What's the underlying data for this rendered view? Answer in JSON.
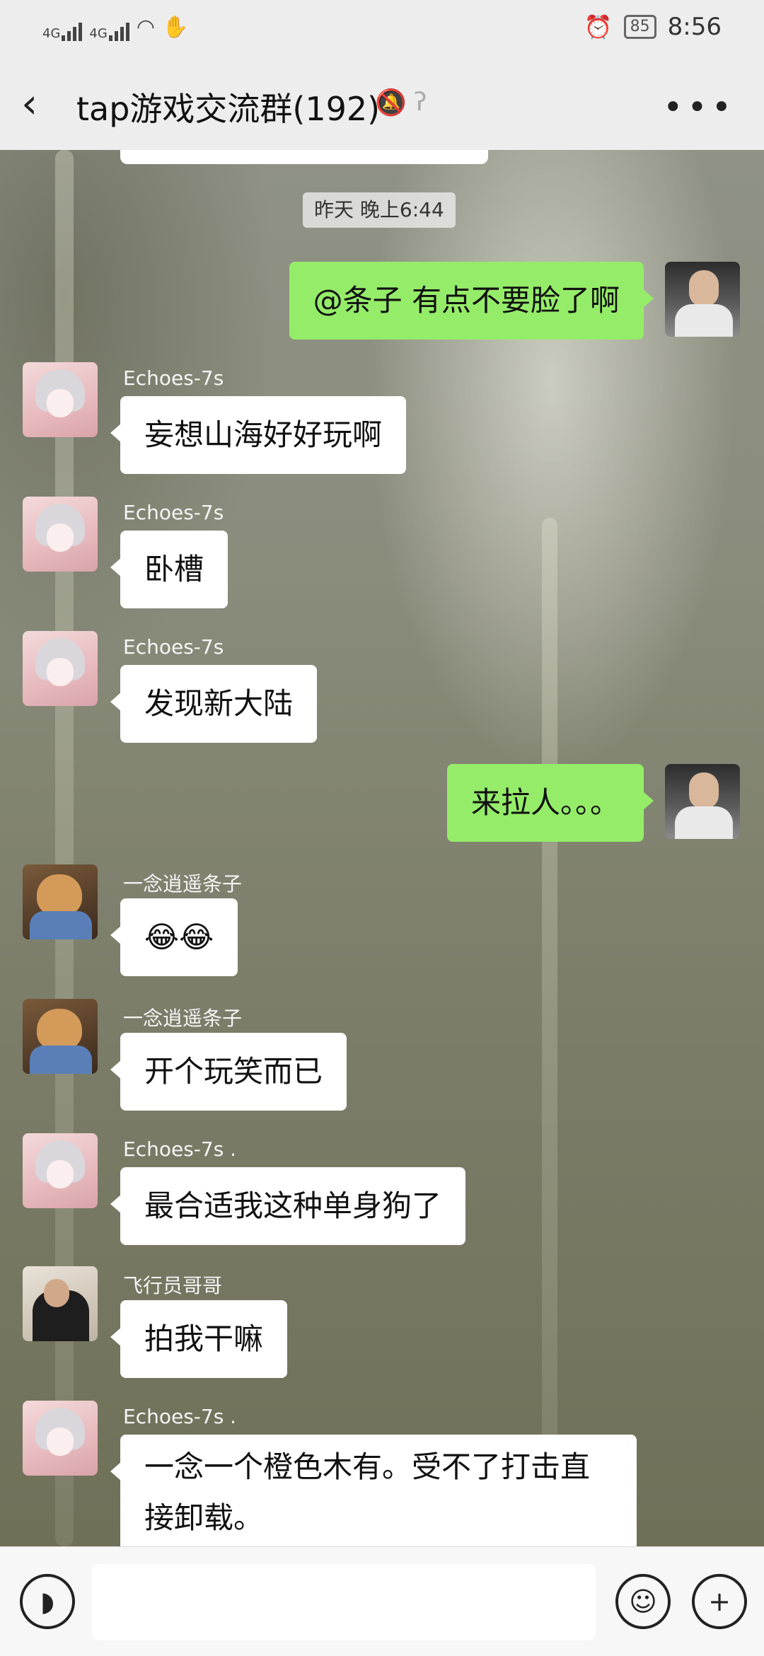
{
  "status_bar": {
    "signal1": "4G",
    "signal2": "4G",
    "battery": "85",
    "time": "8:56"
  },
  "header": {
    "back_icon": "chevron-left",
    "title": "tap游戏交流群(192)",
    "mute_icon": "bell-off",
    "ear_icon": "ear",
    "more_icon": "more-dots"
  },
  "chat": {
    "timestamp": "昨天 晚上6:44",
    "messages": [
      {
        "type": "out",
        "text": "@条子  有点不要脸了啊"
      },
      {
        "type": "in",
        "sender": "Echoes-7s",
        "text": "妄想山海好好玩啊"
      },
      {
        "type": "in",
        "sender": "Echoes-7s",
        "text": "卧槽"
      },
      {
        "type": "in",
        "sender": "Echoes-7s",
        "text": "发现新大陆"
      },
      {
        "type": "out",
        "text": "来拉人。。。"
      },
      {
        "type": "in",
        "sender": "一念逍遥条子",
        "text": "😂😂"
      },
      {
        "type": "in",
        "sender": "一念逍遥条子",
        "text": "开个玩笑而已"
      },
      {
        "type": "in",
        "sender": "Echoes-7s .",
        "text": "最合适我这种单身狗了"
      },
      {
        "type": "in",
        "sender": "飞行员哥哥",
        "text": "拍我干嘛"
      },
      {
        "type": "in",
        "sender": "Echoes-7s .",
        "text": "一念一个橙色木有。受不了打击直接卸载。"
      }
    ]
  },
  "input_bar": {
    "voice_icon": "voice",
    "emoji_icon": "emoji",
    "add_icon": "plus"
  }
}
